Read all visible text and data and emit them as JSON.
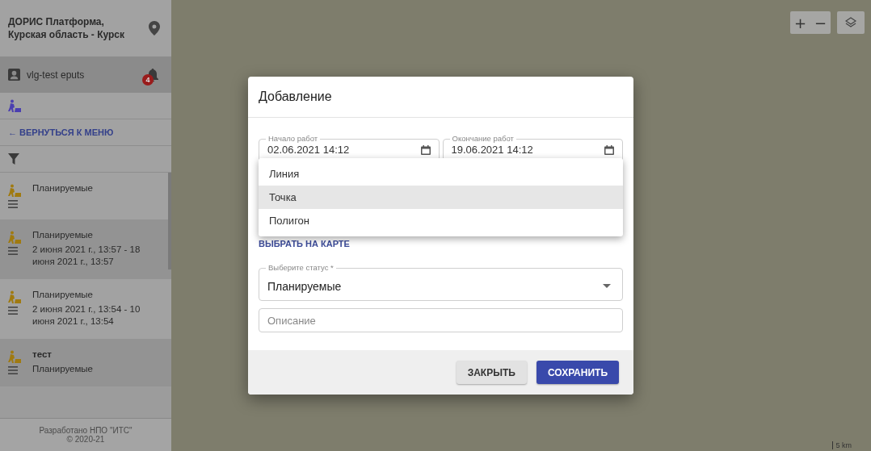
{
  "sidebar": {
    "header": {
      "title": "ДОРИС Платформа, Курская область - Курск"
    },
    "user": {
      "name": "vlg-test eputs",
      "notifications": "4"
    },
    "back_link": "← ВЕРНУТЬСЯ К МЕНЮ",
    "items": [
      {
        "title": "Планируемые",
        "bold": false
      },
      {
        "title": "Планируемые",
        "bold": false,
        "subtitle": "2 июня 2021 г., 13:57 - 18 июня 2021 г., 13:57"
      },
      {
        "title": "Планируемые",
        "bold": false,
        "subtitle": "2 июня 2021 г., 13:54 - 10 июня 2021 г., 13:54"
      },
      {
        "title": "тест",
        "bold": true,
        "subtitle": "Планируемые"
      }
    ],
    "footer": [
      "Разработано НПО \"ИТС\"",
      "© 2020-21"
    ]
  },
  "map": {
    "zoom_in": "+",
    "zoom_out": "−",
    "scale": "5 km"
  },
  "dialog": {
    "title": "Добавление",
    "date_fields": [
      {
        "label": "Начало работ",
        "value": "02.06.2021 14:12"
      },
      {
        "label": "Окончание работ",
        "value": "19.06.2021 14:12"
      }
    ],
    "menu": [
      {
        "label": "Линия",
        "selected": false
      },
      {
        "label": "Точка",
        "selected": true
      },
      {
        "label": "Полигон",
        "selected": false
      }
    ],
    "map_link": "ВЫБРАТЬ НА КАРТЕ",
    "status": {
      "label": "Выберите статус *",
      "value": "Планируемые"
    },
    "description": {
      "placeholder": "Описание"
    },
    "buttons": [
      {
        "label": "ЗАКРЫТЬ",
        "kind": "secondary"
      },
      {
        "label": "СОХРАНИТЬ",
        "kind": "primary"
      }
    ]
  }
}
